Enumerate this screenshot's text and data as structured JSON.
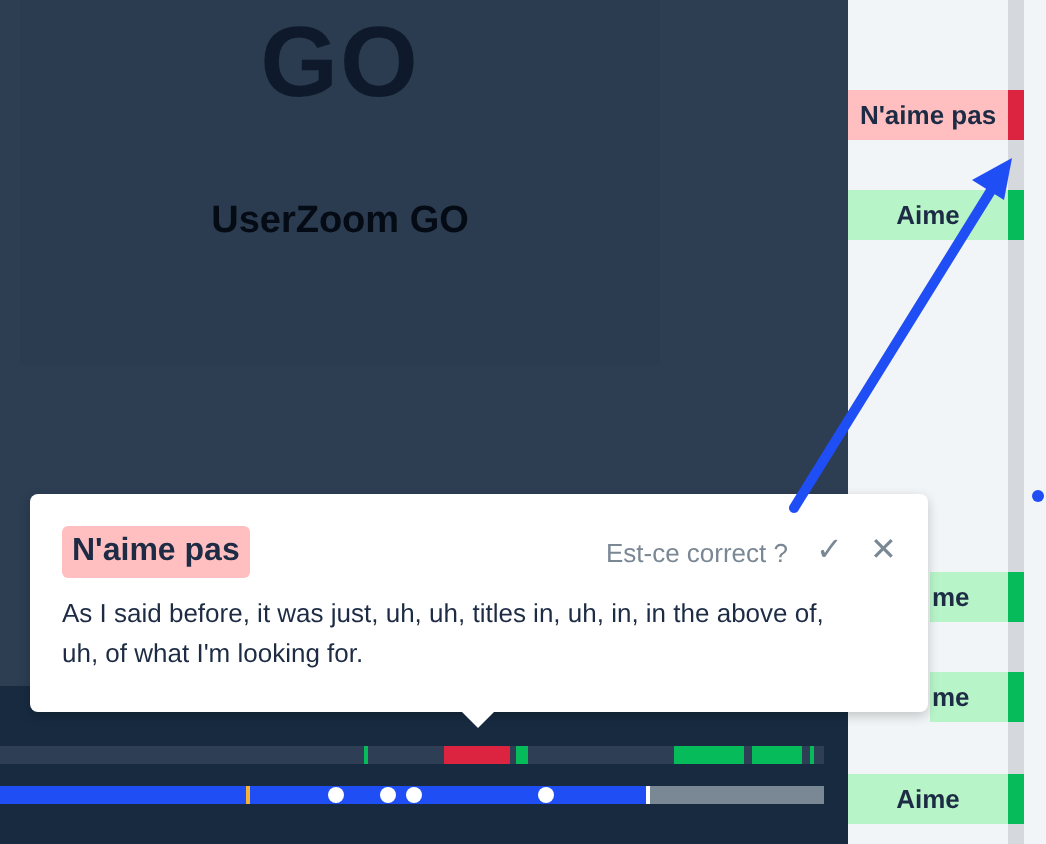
{
  "video": {
    "logo": "GO",
    "title": "UserZoom GO"
  },
  "tags": [
    {
      "label": "N'aime pas",
      "color": "#dc233f",
      "kind": "full"
    },
    {
      "label": "Aime",
      "color": "#05bb5a",
      "kind": "full"
    },
    {
      "label": "me",
      "color": "#05bb5a",
      "kind": "covered"
    },
    {
      "label": "me",
      "color": "#05bb5a",
      "kind": "covered"
    },
    {
      "label": "Aime",
      "color": "#05bb5a",
      "kind": "full"
    }
  ],
  "popup": {
    "tag": "N'aime pas",
    "color": "#ffbfc1",
    "question": "Est-ce correct ?",
    "confirm": "✓",
    "dismiss": "✕",
    "quote": "As I said before, it was just, uh, uh, titles in, uh, in, in the above of, uh, of what I'm looking for."
  }
}
